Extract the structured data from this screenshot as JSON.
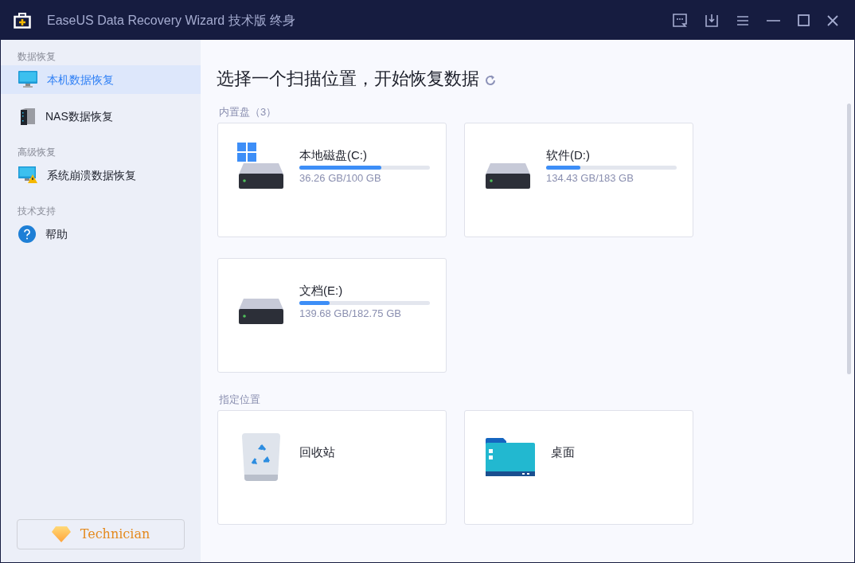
{
  "window": {
    "title": "EaseUS Data Recovery Wizard 技术版 终身"
  },
  "sidebar": {
    "sections": [
      {
        "label": "数据恢复",
        "items": [
          {
            "kind": "monitor",
            "label": "本机数据恢复",
            "selected": true
          },
          {
            "kind": "nas",
            "label": "NAS数据恢复",
            "selected": false
          }
        ]
      },
      {
        "label": "高级恢复",
        "items": [
          {
            "kind": "crash",
            "label": "系统崩溃数据恢复",
            "selected": false
          }
        ]
      },
      {
        "label": "技术支持",
        "items": [
          {
            "kind": "help",
            "label": "帮助",
            "selected": false
          }
        ]
      }
    ],
    "edition_button": "Technician"
  },
  "main": {
    "heading": "选择一个扫描位置，开始恢复数据",
    "sections": [
      {
        "label": "内置盘（3）",
        "cards": [
          {
            "kind": "drive",
            "system": true,
            "name": "本地磁盘(C:)",
            "usage": "36.26 GB/100 GB",
            "level": 0.63
          },
          {
            "kind": "drive",
            "system": false,
            "name": "软件(D:)",
            "usage": "134.43 GB/183 GB",
            "level": 0.26
          },
          {
            "kind": "drive",
            "system": false,
            "name": "文档(E:)",
            "usage": "139.68 GB/182.75 GB",
            "level": 0.23
          }
        ]
      },
      {
        "label": "指定位置",
        "cards": [
          {
            "kind": "recycle-bin",
            "name": "回收站"
          },
          {
            "kind": "folder",
            "name": "桌面"
          }
        ]
      }
    ]
  }
}
